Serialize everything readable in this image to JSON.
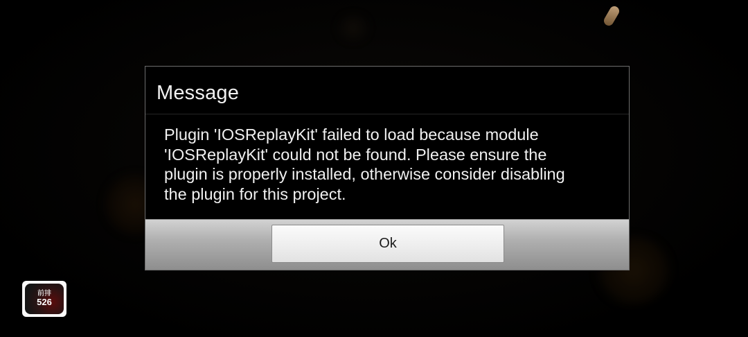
{
  "dialog": {
    "title": "Message",
    "message": "Plugin 'IOSReplayKit' failed to load because module\n'IOSReplayKit' could not be found.  Please ensure the\nplugin is properly installed, otherwise consider disabling\nthe plugin for this project.",
    "ok_label": "Ok"
  },
  "app_badge": {
    "line1": "前排",
    "line2": "526"
  },
  "colors": {
    "dialog_background": "#000000",
    "dialog_border": "#6d6d6d",
    "button_bar_top": "#d2d2d2",
    "button_bar_bottom": "#8e8e8e",
    "text": "#f0f0f0"
  }
}
